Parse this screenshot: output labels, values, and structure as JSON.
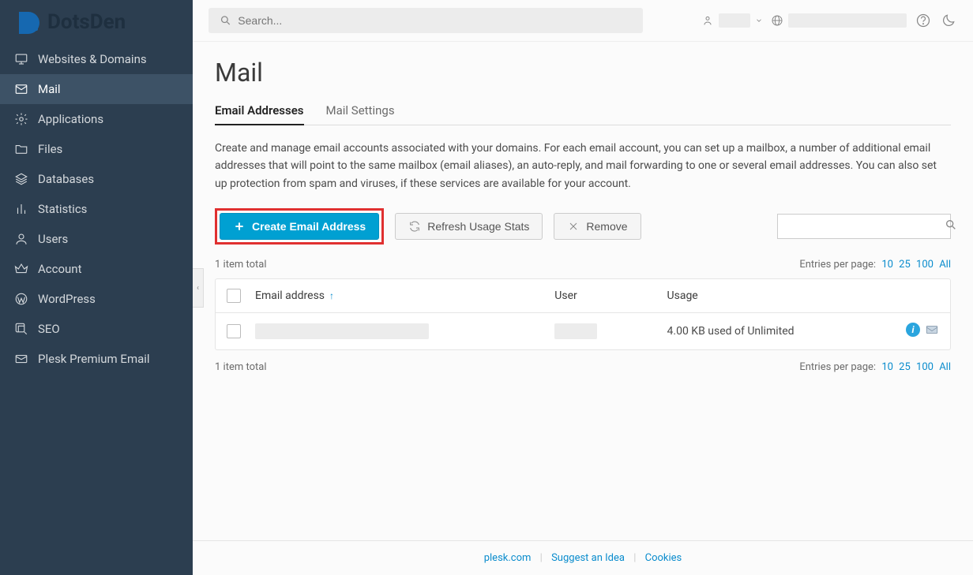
{
  "brand": "DotsDen",
  "sidebar": {
    "items": [
      {
        "label": "Websites & Domains",
        "icon": "monitor"
      },
      {
        "label": "Mail",
        "icon": "mail",
        "active": true
      },
      {
        "label": "Applications",
        "icon": "gear"
      },
      {
        "label": "Files",
        "icon": "folder"
      },
      {
        "label": "Databases",
        "icon": "stack"
      },
      {
        "label": "Statistics",
        "icon": "bars"
      },
      {
        "label": "Users",
        "icon": "users"
      },
      {
        "label": "Account",
        "icon": "crown"
      },
      {
        "label": "WordPress",
        "icon": "wordpress"
      },
      {
        "label": "SEO",
        "icon": "seo"
      },
      {
        "label": "Plesk Premium Email",
        "icon": "envelope"
      }
    ]
  },
  "topbar": {
    "search_placeholder": "Search..."
  },
  "page": {
    "title": "Mail",
    "tabs": [
      {
        "label": "Email Addresses",
        "active": true
      },
      {
        "label": "Mail Settings"
      }
    ],
    "description": "Create and manage email accounts associated with your domains. For each email account, you can set up a mailbox, a number of additional email addresses that will point to the same mailbox (email aliases), an auto-reply, and mail forwarding to one or several email addresses. You can also set up protection from spam and viruses, if these services are available for your account.",
    "buttons": {
      "create": "Create Email Address",
      "refresh": "Refresh Usage Stats",
      "remove": "Remove"
    },
    "total_text": "1 item total",
    "pager_label": "Entries per page:",
    "pager_options": [
      "10",
      "25",
      "100",
      "All"
    ],
    "columns": {
      "email": "Email address",
      "user": "User",
      "usage": "Usage"
    },
    "rows": [
      {
        "email": "",
        "user": "",
        "usage": "4.00 KB used of Unlimited"
      }
    ]
  },
  "footer": {
    "links": [
      "plesk.com",
      "Suggest an Idea",
      "Cookies"
    ]
  }
}
